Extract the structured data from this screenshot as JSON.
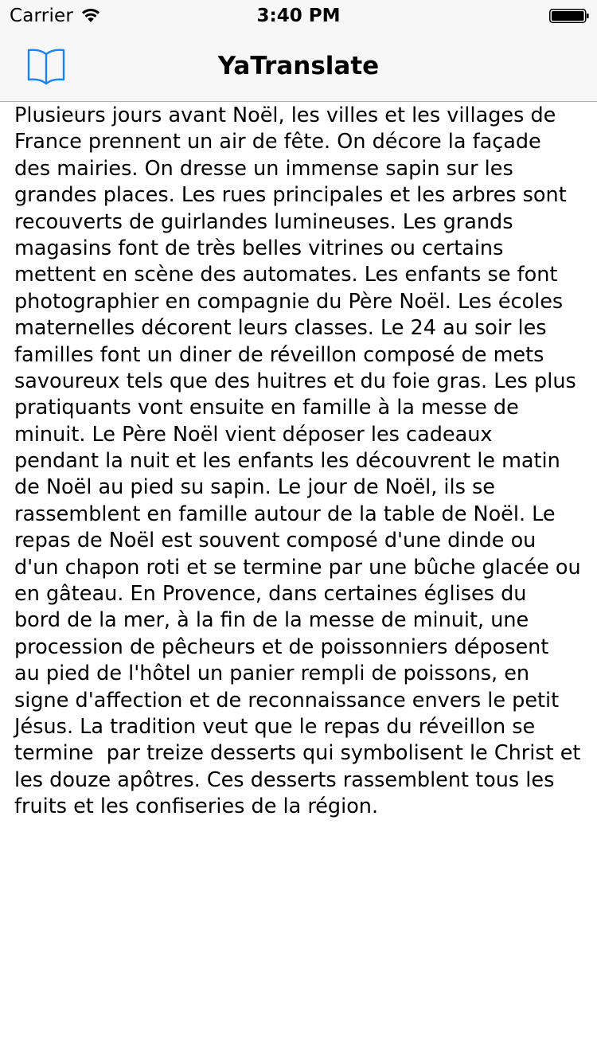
{
  "status_bar": {
    "carrier": "Carrier",
    "time": "3:40 PM",
    "wifi_icon": "wifi-icon",
    "battery_icon": "battery-icon"
  },
  "nav_bar": {
    "title": "YaTranslate",
    "left_button_icon": "book-icon",
    "accent_color": "#1a82fb"
  },
  "content": {
    "lines": [
      "Plusieurs jours avant Noël, les villes et les villages de",
      "France prennent un air de fête. On décore la façade",
      "des mairies. On dresse un immense sapin sur les",
      "grandes places. Les rues principales et les arbres sont",
      "recouverts de guirlandes lumineuses. Les grands",
      "magasins font de très belles vitrines ou certains",
      "mettent en scène des automates. Les enfants se font",
      "photographier en compagnie du Père Noël. Les écoles",
      "maternelles décorent leurs classes. Le 24 au soir les",
      "familles font un diner de réveillon composé de mets",
      "savoureux tels que des huitres et du foie gras. Les plus",
      "pratiquants vont ensuite en famille à la messe de",
      "minuit. Le Père Noël vient déposer les cadeaux",
      "pendant la nuit et les enfants les découvrent le matin",
      "de Noël au pied su sapin. Le jour de Noël, ils se",
      "rassemblent en famille autour de la table de Noël. Le",
      "repas de Noël est souvent composé d'une dinde ou",
      "d'un chapon roti et se termine par une bûche glacée ou",
      "en gâteau. En Provence, dans certaines églises du",
      "bord de la mer, à la fin de la messe de minuit, une",
      "procession de pêcheurs et de poissonniers déposent",
      "au pied de l'hôtel un panier rempli de poissons, en",
      "signe d'affection et de reconnaissance envers le petit",
      "Jésus. La tradition veut que le repas du réveillon se",
      "termine  par treize desserts qui symbolisent le Christ et",
      "les douze apôtres. Ces desserts rassemblent tous les",
      "fruits et les confiseries de la région."
    ]
  }
}
